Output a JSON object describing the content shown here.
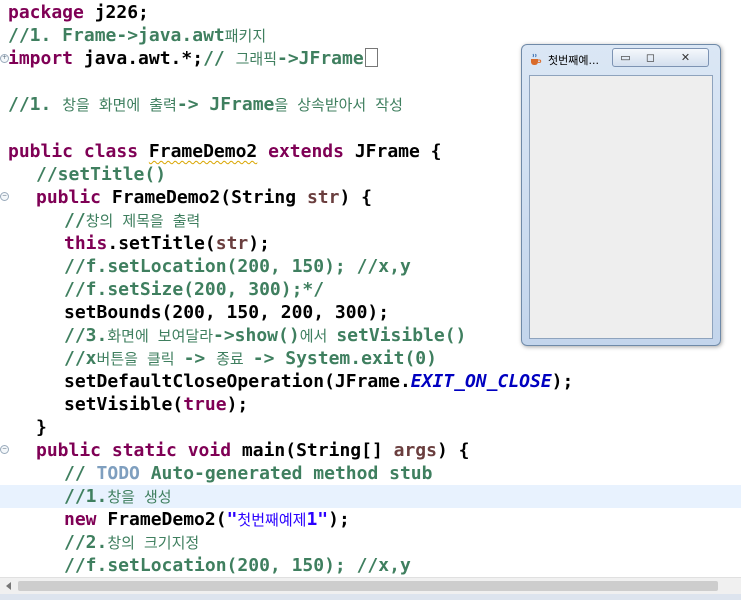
{
  "editor": {
    "lines": {
      "l1": {
        "kw": "package ",
        "rest": "j226;"
      },
      "l2": {
        "comment": "//1. Frame->java.awt",
        "comment_ko": "패키지"
      },
      "l3": {
        "kw": "import ",
        "rest": "java.awt.*;",
        "comment": "// ",
        "comment_ko": "그래픽",
        "comment2": "->JFrame"
      },
      "l4": {
        "comment": "//1. ",
        "comment_ko": "창을 화면에 출력",
        "comment2": "-> JFrame",
        "comment_ko2": "을 상속받아서 작성"
      },
      "l5": {
        "kw": "public class ",
        "class_name": "FrameDemo2",
        "kw2": " extends ",
        "rest": "JFrame {"
      },
      "l6": {
        "comment": "//setTitle()"
      },
      "l7": {
        "kw": "public ",
        "rest": "FrameDemo2(String ",
        "param": "str",
        "rest2": ") {"
      },
      "l8": {
        "comment": "//",
        "comment_ko": "창의 제목을 출력"
      },
      "l9": {
        "kw": "this",
        "rest": ".setTitle(",
        "param": "str",
        "rest2": ");"
      },
      "l10": {
        "comment": "//f.setLocation(200, 150); //x,y"
      },
      "l11": {
        "comment": "//f.setSize(200, 300);*/"
      },
      "l12": {
        "rest": "setBounds(200, 150, 200, 300);"
      },
      "l13": {
        "comment": "//3.",
        "comment_ko": "화면에 보여달라",
        "comment2": "->show()",
        "comment_ko2": "에서 ",
        "comment3": "setVisible()"
      },
      "l14": {
        "comment": "//x",
        "comment_ko": "버튼을 클릭 ",
        "comment2": "-> ",
        "comment_ko2": "종료 ",
        "comment3": "-> System.exit(0)"
      },
      "l15": {
        "rest": "setDefaultCloseOperation(JFrame.",
        "field": "EXIT_ON_CLOSE",
        "rest2": ");"
      },
      "l16": {
        "rest": "setVisible(",
        "kw": "true",
        "rest2": ");"
      },
      "l17": {
        "rest": "}"
      },
      "l18": {
        "kw": "public static void ",
        "rest": "main(String[] ",
        "param": "args",
        "rest2": ") {"
      },
      "l19": {
        "comment": "// ",
        "todo": "TODO",
        "comment2": " Auto-generated method stub"
      },
      "l20": {
        "comment": "//1.",
        "comment_ko": "창을 생성"
      },
      "l21": {
        "kw": "new ",
        "rest": "FrameDemo2(",
        "string": "\"",
        "string_ko": "첫번째예제",
        "string2": "1\"",
        "rest2": ");"
      },
      "l22": {
        "comment": "//2.",
        "comment_ko": "창의 크기지정"
      },
      "l23": {
        "comment": "//f.setLocation(200, 150); //x,y"
      }
    }
  },
  "jframe": {
    "title": "첫번째예...",
    "minimize_glyph": "▭",
    "maximize_glyph": "◻",
    "close_glyph": "✕",
    "icon": "java-cup-icon"
  },
  "colors": {
    "keyword": "#7f0055",
    "comment": "#3f7f5f",
    "string": "#2a00ff",
    "field": "#0000c0",
    "parameter": "#6a3e3e",
    "todo": "#7f9fbf",
    "current_line": "#e8f2fe"
  }
}
